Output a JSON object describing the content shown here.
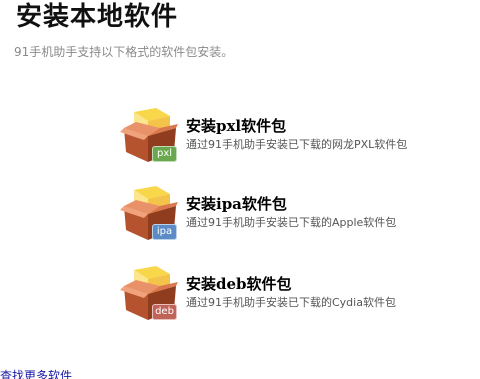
{
  "header": {
    "title": "安装本地软件",
    "subtitle": "91手机助手支持以下格式的软件包安装。"
  },
  "options": [
    {
      "title": "安装pxl软件包",
      "description": "通过91手机助手安装已下载的网龙PXL软件包",
      "badge": "pxl",
      "badge_color": "#6aa84f",
      "icon": "package-box-icon"
    },
    {
      "title": "安装ipa软件包",
      "description": "通过91手机助手安装已下载的Apple软件包",
      "badge": "ipa",
      "badge_color": "#5b8cc8",
      "icon": "package-box-icon"
    },
    {
      "title": "安装deb软件包",
      "description": "通过91手机助手安装已下载的Cydia软件包",
      "badge": "deb",
      "badge_color": "#c0645a",
      "icon": "package-box-icon"
    }
  ],
  "footer": {
    "more_link": "查找更多软件"
  },
  "colors": {
    "box_front": "#b4532e",
    "box_side": "#8f3c1f",
    "box_lid": "#e9926a",
    "box_inner": "#f7c43a"
  }
}
